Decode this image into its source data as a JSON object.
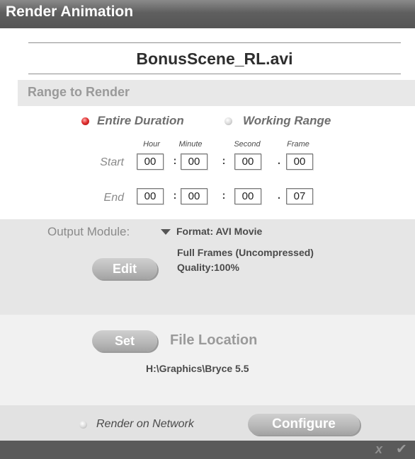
{
  "window": {
    "title": "Render Animation"
  },
  "file": {
    "name": "BonusScene_RL.avi"
  },
  "range": {
    "header": "Range to Render",
    "options": [
      {
        "label": "Entire Duration",
        "selected": true
      },
      {
        "label": "Working Range",
        "selected": false
      }
    ],
    "columns": [
      "Hour",
      "Minute",
      "Second",
      "Frame"
    ],
    "start": {
      "label": "Start",
      "values": [
        "00",
        "00",
        "00",
        "00"
      ]
    },
    "end": {
      "label": "End",
      "values": [
        "00",
        "00",
        "00",
        "07"
      ]
    },
    "separators": [
      ":",
      ":",
      "."
    ]
  },
  "output": {
    "label": "Output Module:",
    "format": "Format: AVI Movie",
    "details_line1": "Full Frames (Uncompressed)",
    "details_line2": "Quality:100%",
    "edit_label": "Edit"
  },
  "location": {
    "set_label": "Set",
    "title": "File Location",
    "path": "H:\\Graphics\\Bryce 5.5"
  },
  "network": {
    "label": "Render on Network",
    "configure_label": "Configure"
  },
  "footer": {
    "cancel_icon": "x",
    "ok_icon": "✔"
  },
  "colors": {
    "titlebar": "#5f5f5f",
    "radio_selected": "#e03030",
    "pill_button": "#b9b9b9"
  }
}
